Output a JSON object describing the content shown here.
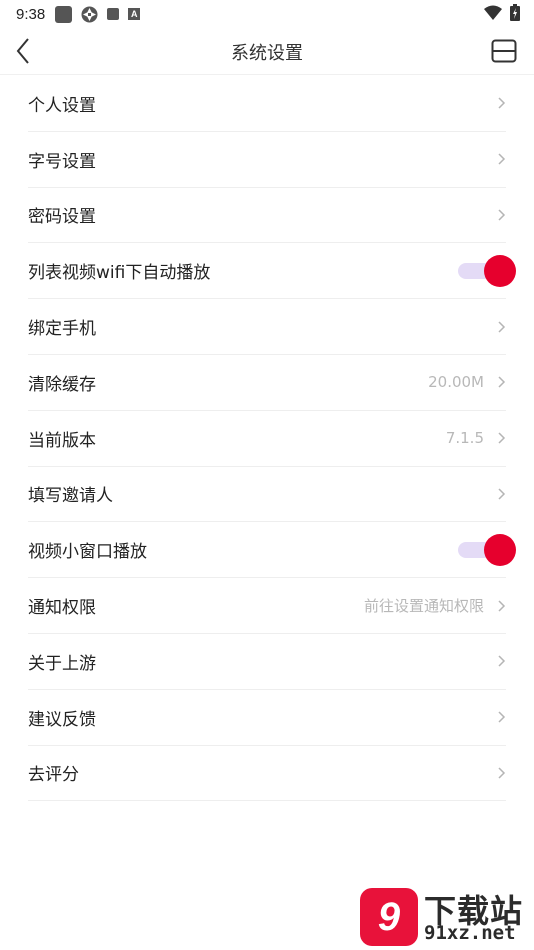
{
  "status_bar": {
    "time": "9:38",
    "icons": [
      "notification-square-icon",
      "aperture-icon",
      "stop-square-icon",
      "a-badge-icon"
    ],
    "right_icons": [
      "wifi-icon",
      "battery-charging-icon"
    ]
  },
  "header": {
    "title": "系统设置",
    "back_icon": "chevron-left-icon",
    "right_icon": "layout-split-icon"
  },
  "settings": [
    {
      "label": "个人设置",
      "value": "",
      "control": "chevron"
    },
    {
      "label": "字号设置",
      "value": "",
      "control": "chevron"
    },
    {
      "label": "密码设置",
      "value": "",
      "control": "chevron"
    },
    {
      "label": "列表视频wifi下自动播放",
      "value": "",
      "control": "toggle",
      "on": true
    },
    {
      "label": "绑定手机",
      "value": "",
      "control": "chevron"
    },
    {
      "label": "清除缓存",
      "value": "20.00M",
      "control": "chevron"
    },
    {
      "label": "当前版本",
      "value": "7.1.5",
      "control": "chevron"
    },
    {
      "label": "填写邀请人",
      "value": "",
      "control": "chevron"
    },
    {
      "label": "视频小窗口播放",
      "value": "",
      "control": "toggle",
      "on": true
    },
    {
      "label": "通知权限",
      "value": "前往设置通知权限",
      "control": "chevron"
    },
    {
      "label": "关于上游",
      "value": "",
      "control": "chevron"
    },
    {
      "label": "建议反馈",
      "value": "",
      "control": "chevron"
    },
    {
      "label": "去评分",
      "value": "",
      "control": "chevron"
    }
  ],
  "watermark": {
    "badge": "9",
    "title": "下载站",
    "url": "91xz.net"
  },
  "colors": {
    "accent": "#e6002d",
    "toggle_track": "#e4dbf6",
    "value_text": "#b8b8b8",
    "divider": "#eeeeee"
  }
}
